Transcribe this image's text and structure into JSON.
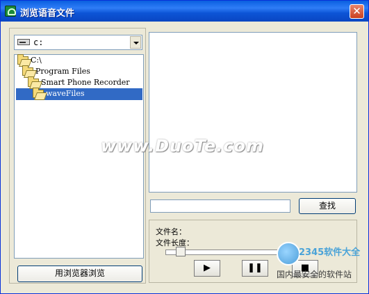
{
  "window": {
    "title": "浏览语音文件",
    "close_symbol": "✕",
    "accent": "#0a5fe0"
  },
  "drive_select": {
    "value": "c:",
    "icon": "drive-icon"
  },
  "tree": {
    "items": [
      {
        "label": "C:\\",
        "icon": "open-folder-icon"
      },
      {
        "label": "Program Files",
        "icon": "open-folder-icon"
      },
      {
        "label": "Smart Phone Recorder",
        "icon": "open-folder-icon"
      },
      {
        "label": "waveFiles",
        "icon": "open-folder-icon",
        "selected": true
      }
    ],
    "selection_color": "#316ac5"
  },
  "buttons": {
    "browse_label": "用浏览器浏览",
    "search_label": "查找",
    "play_symbol": "▶",
    "pause_symbol": "❚❚",
    "stop_symbol": "■"
  },
  "info": {
    "file_name_label": "文件名：",
    "file_length_label": "文件长度："
  },
  "search": {
    "value": ""
  },
  "overlay": {
    "watermark": "www.DuoTe.com",
    "logo_text": "2345软件大全",
    "logo_sub": "国内最安全的软件站"
  }
}
